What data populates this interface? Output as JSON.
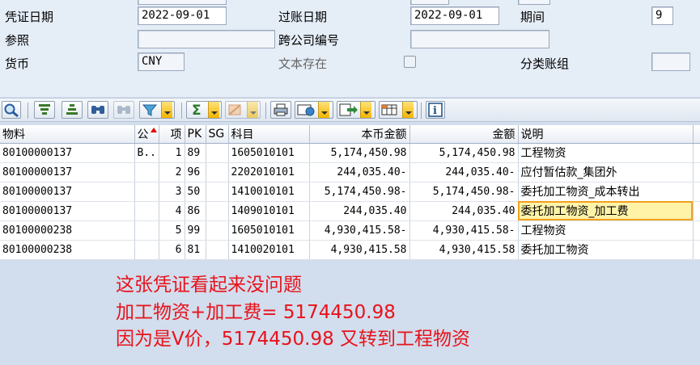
{
  "header": {
    "row1": {
      "doc_date_label": "凭证日期",
      "doc_date_value": "2022-09-01",
      "posting_date_label": "过账日期",
      "posting_date_value": "2022-09-01",
      "period_label": "期间",
      "period_value": "9"
    },
    "row2": {
      "reference_label": "参照",
      "reference_value": "",
      "cross_company_label": "跨公司编号",
      "cross_company_value": ""
    },
    "row3": {
      "currency_label": "货币",
      "currency_value": "CNY",
      "text_exists_label": "文本存在",
      "ledger_group_label": "分类账组",
      "ledger_group_value": ""
    }
  },
  "toolbar": {
    "buttons": [
      "details-icon",
      "sort-ascending-icon",
      "sort-descending-icon",
      "find-icon",
      "find-next-icon",
      "filter-icon",
      "sum-icon",
      "subtotal-icon",
      "print-icon",
      "views-icon",
      "export-icon",
      "layout-icon",
      "info-icon"
    ]
  },
  "grid": {
    "columns": [
      "物料",
      "公",
      "项",
      "PK",
      "SG",
      "科目",
      "本币金额",
      "金额",
      "说明"
    ],
    "rows": [
      {
        "material": "80100000137",
        "company": "B...",
        "item": "1",
        "pk": "89",
        "sg": "",
        "account": "1605010101",
        "local_amount": "5,174,450.98",
        "amount": "5,174,450.98",
        "text": "工程物资"
      },
      {
        "material": "80100000137",
        "company": "",
        "item": "2",
        "pk": "96",
        "sg": "",
        "account": "2202010101",
        "local_amount": "244,035.40-",
        "amount": "244,035.40-",
        "text": "应付暂估款_集团外"
      },
      {
        "material": "80100000137",
        "company": "",
        "item": "3",
        "pk": "50",
        "sg": "",
        "account": "1410010101",
        "local_amount": "5,174,450.98-",
        "amount": "5,174,450.98-",
        "text": "委托加工物资_成本转出"
      },
      {
        "material": "80100000137",
        "company": "",
        "item": "4",
        "pk": "86",
        "sg": "",
        "account": "1409010101",
        "local_amount": "244,035.40",
        "amount": "244,035.40",
        "text": "委托加工物资_加工费"
      },
      {
        "material": "80100000238",
        "company": "",
        "item": "5",
        "pk": "99",
        "sg": "",
        "account": "1605010101",
        "local_amount": "4,930,415.58-",
        "amount": "4,930,415.58-",
        "text": "工程物资"
      },
      {
        "material": "80100000238",
        "company": "",
        "item": "6",
        "pk": "81",
        "sg": "",
        "account": "1410020101",
        "local_amount": "4,930,415.58",
        "amount": "4,930,415.58",
        "text": "委托加工物资"
      }
    ]
  },
  "annotation": {
    "line1": "这张凭证看起来没问题",
    "line2": "加工物资+加工费= 5174450.98",
    "line3": "因为是V价，5174450.98 又转到工程物资"
  },
  "colors": {
    "annotation": "#e8121a",
    "selection_fill": "#fff3a8",
    "selection_border": "#f2a11d",
    "form_background": "#e5edf7",
    "page_background": "#d2dded"
  }
}
